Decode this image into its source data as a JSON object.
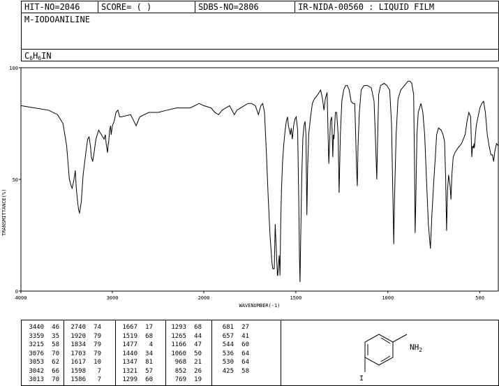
{
  "header": {
    "hit_no": "HIT-NO=2046",
    "score": "SCORE=  (   )",
    "sdbs_no": "SDBS-NO=2806",
    "ir_info": "IR-NIDA-00560 : LIQUID FILM",
    "compound_name": "M-IODOANILINE",
    "formula": {
      "c": "C",
      "c_n": "6",
      "h": "H",
      "h_n": "6",
      "rest": "IN"
    }
  },
  "chart_data": {
    "type": "line",
    "xlabel": "WAVENUMBER(-1)",
    "ylabel": "TRANSMITTANCE(%)",
    "xlim": [
      4000,
      400
    ],
    "ylim": [
      0,
      100
    ],
    "x_ticks": [
      "4000",
      "3000",
      "2000",
      "1500",
      "1000",
      "500"
    ],
    "x_tick_values": [
      4000,
      3000,
      2000,
      1500,
      1000,
      500
    ],
    "y_ticks": [
      "100",
      "50",
      "0"
    ],
    "y_tick_values": [
      100,
      50,
      0
    ],
    "grid": false,
    "series": [
      {
        "points": [
          [
            4000,
            83
          ],
          [
            3850,
            82
          ],
          [
            3700,
            81
          ],
          [
            3600,
            79
          ],
          [
            3540,
            75
          ],
          [
            3500,
            65
          ],
          [
            3470,
            50
          ],
          [
            3450,
            47
          ],
          [
            3440,
            46
          ],
          [
            3420,
            50
          ],
          [
            3405,
            54
          ],
          [
            3395,
            46
          ],
          [
            3380,
            40
          ],
          [
            3368,
            36
          ],
          [
            3359,
            35
          ],
          [
            3340,
            40
          ],
          [
            3320,
            52
          ],
          [
            3290,
            62
          ],
          [
            3270,
            68
          ],
          [
            3255,
            69
          ],
          [
            3240,
            65
          ],
          [
            3230,
            60
          ],
          [
            3215,
            58
          ],
          [
            3200,
            62
          ],
          [
            3180,
            68
          ],
          [
            3150,
            72
          ],
          [
            3120,
            70
          ],
          [
            3090,
            68
          ],
          [
            3076,
            70
          ],
          [
            3068,
            66
          ],
          [
            3053,
            62
          ],
          [
            3045,
            66
          ],
          [
            3042,
            66
          ],
          [
            3030,
            72
          ],
          [
            3020,
            74
          ],
          [
            3013,
            70
          ],
          [
            3000,
            74
          ],
          [
            2980,
            76
          ],
          [
            2960,
            80
          ],
          [
            2940,
            81
          ],
          [
            2920,
            78
          ],
          [
            2900,
            78
          ],
          [
            2800,
            79
          ],
          [
            2740,
            74
          ],
          [
            2700,
            78
          ],
          [
            2600,
            80
          ],
          [
            2500,
            80
          ],
          [
            2400,
            81
          ],
          [
            2300,
            82
          ],
          [
            2200,
            82
          ],
          [
            2150,
            82
          ],
          [
            2100,
            83
          ],
          [
            2050,
            84
          ],
          [
            2000,
            83
          ],
          [
            1960,
            82
          ],
          [
            1940,
            80
          ],
          [
            1920,
            79
          ],
          [
            1900,
            81
          ],
          [
            1880,
            82
          ],
          [
            1860,
            83
          ],
          [
            1834,
            79
          ],
          [
            1820,
            81
          ],
          [
            1800,
            82
          ],
          [
            1780,
            83
          ],
          [
            1760,
            84
          ],
          [
            1740,
            84
          ],
          [
            1720,
            83
          ],
          [
            1703,
            79
          ],
          [
            1690,
            83
          ],
          [
            1680,
            84
          ],
          [
            1670,
            80
          ],
          [
            1660,
            62
          ],
          [
            1650,
            42
          ],
          [
            1640,
            25
          ],
          [
            1630,
            13
          ],
          [
            1625,
            10
          ],
          [
            1617,
            10
          ],
          [
            1612,
            30
          ],
          [
            1607,
            20
          ],
          [
            1600,
            7
          ],
          [
            1598,
            7
          ],
          [
            1594,
            12
          ],
          [
            1590,
            16
          ],
          [
            1586,
            7
          ],
          [
            1582,
            30
          ],
          [
            1578,
            45
          ],
          [
            1572,
            58
          ],
          [
            1565,
            66
          ],
          [
            1558,
            72
          ],
          [
            1552,
            76
          ],
          [
            1545,
            78
          ],
          [
            1540,
            74
          ],
          [
            1530,
            70
          ],
          [
            1525,
            73
          ],
          [
            1519,
            68
          ],
          [
            1512,
            74
          ],
          [
            1505,
            77
          ],
          [
            1498,
            78
          ],
          [
            1490,
            72
          ],
          [
            1484,
            40
          ],
          [
            1480,
            15
          ],
          [
            1477,
            4
          ],
          [
            1474,
            20
          ],
          [
            1468,
            50
          ],
          [
            1462,
            68
          ],
          [
            1456,
            74
          ],
          [
            1450,
            76
          ],
          [
            1445,
            70
          ],
          [
            1440,
            34
          ],
          [
            1436,
            55
          ],
          [
            1430,
            70
          ],
          [
            1420,
            78
          ],
          [
            1410,
            84
          ],
          [
            1400,
            86
          ],
          [
            1380,
            88
          ],
          [
            1365,
            90
          ],
          [
            1355,
            86
          ],
          [
            1347,
            81
          ],
          [
            1340,
            86
          ],
          [
            1330,
            89
          ],
          [
            1321,
            57
          ],
          [
            1312,
            76
          ],
          [
            1305,
            78
          ],
          [
            1299,
            60
          ],
          [
            1296,
            70
          ],
          [
            1293,
            68
          ],
          [
            1285,
            80
          ],
          [
            1278,
            80
          ],
          [
            1270,
            70
          ],
          [
            1265,
            44
          ],
          [
            1258,
            70
          ],
          [
            1250,
            85
          ],
          [
            1240,
            90
          ],
          [
            1230,
            92
          ],
          [
            1220,
            92
          ],
          [
            1210,
            90
          ],
          [
            1200,
            85
          ],
          [
            1190,
            84
          ],
          [
            1180,
            84
          ],
          [
            1175,
            70
          ],
          [
            1170,
            55
          ],
          [
            1166,
            47
          ],
          [
            1162,
            65
          ],
          [
            1155,
            80
          ],
          [
            1145,
            90
          ],
          [
            1130,
            92
          ],
          [
            1110,
            92
          ],
          [
            1090,
            91
          ],
          [
            1075,
            85
          ],
          [
            1066,
            65
          ],
          [
            1060,
            50
          ],
          [
            1055,
            70
          ],
          [
            1050,
            88
          ],
          [
            1040,
            92
          ],
          [
            1020,
            93
          ],
          [
            1005,
            92
          ],
          [
            990,
            90
          ],
          [
            980,
            75
          ],
          [
            972,
            40
          ],
          [
            968,
            21
          ],
          [
            964,
            40
          ],
          [
            955,
            70
          ],
          [
            945,
            86
          ],
          [
            930,
            90
          ],
          [
            910,
            92
          ],
          [
            900,
            93
          ],
          [
            890,
            94
          ],
          [
            880,
            94
          ],
          [
            870,
            93
          ],
          [
            860,
            88
          ],
          [
            855,
            55
          ],
          [
            852,
            26
          ],
          [
            848,
            40
          ],
          [
            842,
            70
          ],
          [
            835,
            80
          ],
          [
            820,
            84
          ],
          [
            810,
            80
          ],
          [
            800,
            70
          ],
          [
            790,
            50
          ],
          [
            780,
            30
          ],
          [
            769,
            19
          ],
          [
            760,
            35
          ],
          [
            750,
            50
          ],
          [
            742,
            60
          ],
          [
            735,
            70
          ],
          [
            725,
            73
          ],
          [
            710,
            72
          ],
          [
            700,
            70
          ],
          [
            692,
            67
          ],
          [
            686,
            50
          ],
          [
            681,
            27
          ],
          [
            676,
            45
          ],
          [
            670,
            52
          ],
          [
            662,
            47
          ],
          [
            657,
            41
          ],
          [
            652,
            52
          ],
          [
            645,
            60
          ],
          [
            635,
            62
          ],
          [
            620,
            64
          ],
          [
            600,
            66
          ],
          [
            580,
            70
          ],
          [
            570,
            76
          ],
          [
            560,
            80
          ],
          [
            550,
            78
          ],
          [
            544,
            60
          ],
          [
            540,
            65
          ],
          [
            536,
            64
          ],
          [
            532,
            66
          ],
          [
            530,
            64
          ],
          [
            520,
            74
          ],
          [
            510,
            78
          ],
          [
            500,
            82
          ],
          [
            490,
            84
          ],
          [
            480,
            85
          ],
          [
            470,
            80
          ],
          [
            460,
            70
          ],
          [
            450,
            65
          ],
          [
            440,
            61
          ],
          [
            432,
            61
          ],
          [
            425,
            58
          ],
          [
            420,
            62
          ],
          [
            410,
            66
          ],
          [
            400,
            65
          ]
        ]
      }
    ]
  },
  "peak_table": {
    "columns": [
      [
        [
          "3440",
          "46"
        ],
        [
          "3359",
          "35"
        ],
        [
          "3215",
          "58"
        ],
        [
          "3076",
          "70"
        ],
        [
          "3053",
          "62"
        ],
        [
          "3042",
          "66"
        ],
        [
          "3013",
          "70"
        ]
      ],
      [
        [
          "2740",
          "74"
        ],
        [
          "1920",
          "79"
        ],
        [
          "1834",
          "79"
        ],
        [
          "1703",
          "79"
        ],
        [
          "1617",
          "10"
        ],
        [
          "1598",
          "7"
        ],
        [
          "1586",
          "7"
        ]
      ],
      [
        [
          "1667",
          "17"
        ],
        [
          "1519",
          "68"
        ],
        [
          "1477",
          "4"
        ],
        [
          "1440",
          "34"
        ],
        [
          "1347",
          "81"
        ],
        [
          "1321",
          "57"
        ],
        [
          "1299",
          "60"
        ]
      ],
      [
        [
          "1293",
          "68"
        ],
        [
          "1265",
          "44"
        ],
        [
          "1166",
          "47"
        ],
        [
          "1060",
          "50"
        ],
        [
          "968",
          "21"
        ],
        [
          "852",
          "26"
        ],
        [
          "769",
          "19"
        ]
      ],
      [
        [
          "681",
          "27"
        ],
        [
          "657",
          "41"
        ],
        [
          "544",
          "60"
        ],
        [
          "536",
          "64"
        ],
        [
          "530",
          "64"
        ],
        [
          "425",
          "58"
        ]
      ]
    ]
  },
  "structure": {
    "amine_label": "NH",
    "amine_sub": "2",
    "iodine_label": "I"
  }
}
